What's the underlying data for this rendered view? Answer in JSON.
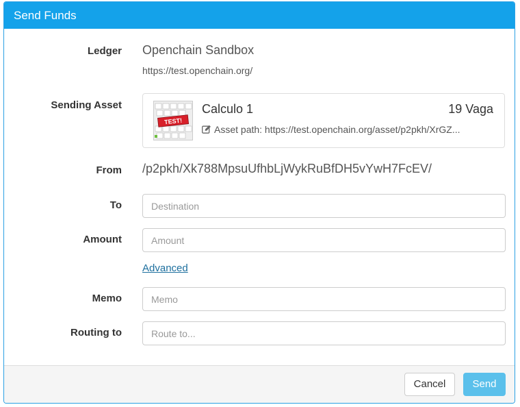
{
  "dialog": {
    "title": "Send Funds"
  },
  "labels": {
    "ledger": "Ledger",
    "sending_asset": "Sending Asset",
    "from": "From",
    "to": "To",
    "amount": "Amount",
    "memo": "Memo",
    "routing_to": "Routing to"
  },
  "ledger": {
    "name": "Openchain Sandbox",
    "url": "https://test.openchain.org/"
  },
  "asset": {
    "name": "Calculo 1",
    "balance": "19 Vaga",
    "path": "Asset path: https://test.openchain.org/asset/p2pkh/XrGZ...",
    "thumb_text": "TEST!",
    "edit_icon": "pencil-square-icon"
  },
  "from": {
    "value": "/p2pkh/Xk788MpsuUfhbLjWykRuBfDH5vYwH7FcEV/"
  },
  "inputs": {
    "to_placeholder": "Destination",
    "to_value": "",
    "amount_placeholder": "Amount",
    "amount_value": "",
    "memo_placeholder": "Memo",
    "memo_value": "",
    "routing_placeholder": "Route to...",
    "routing_value": ""
  },
  "links": {
    "advanced": "Advanced"
  },
  "buttons": {
    "cancel": "Cancel",
    "send": "Send"
  },
  "colors": {
    "header": "#14a2ea",
    "send_button": "#5bc0eb",
    "link": "#1d6f9e"
  }
}
